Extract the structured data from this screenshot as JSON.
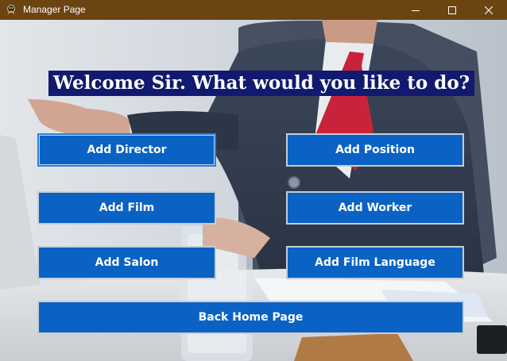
{
  "window": {
    "title": "Manager Page"
  },
  "main": {
    "heading": "Welcome Sir. What would you like to do?",
    "buttons": {
      "add_director": "Add Director",
      "add_position": "Add Position",
      "add_film": "Add Film",
      "add_worker": "Add Worker",
      "add_salon": "Add Salon",
      "add_film_language": "Add Film Language",
      "back_home": "Back Home Page"
    }
  },
  "colors": {
    "titlebar": "#6b4411",
    "heading_bg": "#111a6e",
    "button_bg": "#0a62c4"
  }
}
